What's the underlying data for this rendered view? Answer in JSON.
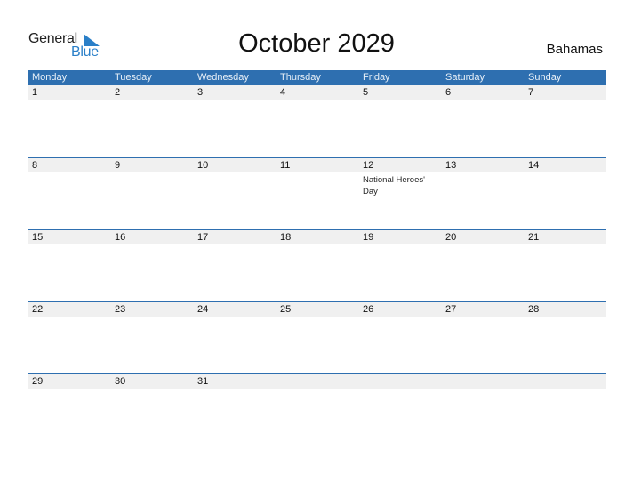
{
  "logo": {
    "word1": "General",
    "word2": "Blue"
  },
  "title": "October 2029",
  "country": "Bahamas",
  "colors": {
    "accent": "#2e6fb0",
    "logo_blue": "#2a7fc8",
    "row_bg": "#f0f0f0"
  },
  "weekdays": [
    "Monday",
    "Tuesday",
    "Wednesday",
    "Thursday",
    "Friday",
    "Saturday",
    "Sunday"
  ],
  "weeks": [
    {
      "days": [
        "1",
        "2",
        "3",
        "4",
        "5",
        "6",
        "7"
      ],
      "events": [
        "",
        "",
        "",
        "",
        "",
        "",
        ""
      ]
    },
    {
      "days": [
        "8",
        "9",
        "10",
        "11",
        "12",
        "13",
        "14"
      ],
      "events": [
        "",
        "",
        "",
        "",
        "National Heroes' Day",
        "",
        ""
      ]
    },
    {
      "days": [
        "15",
        "16",
        "17",
        "18",
        "19",
        "20",
        "21"
      ],
      "events": [
        "",
        "",
        "",
        "",
        "",
        "",
        ""
      ]
    },
    {
      "days": [
        "22",
        "23",
        "24",
        "25",
        "26",
        "27",
        "28"
      ],
      "events": [
        "",
        "",
        "",
        "",
        "",
        "",
        ""
      ]
    },
    {
      "days": [
        "29",
        "30",
        "31",
        "",
        "",
        "",
        ""
      ],
      "events": [
        "",
        "",
        "",
        "",
        "",
        "",
        ""
      ]
    }
  ]
}
